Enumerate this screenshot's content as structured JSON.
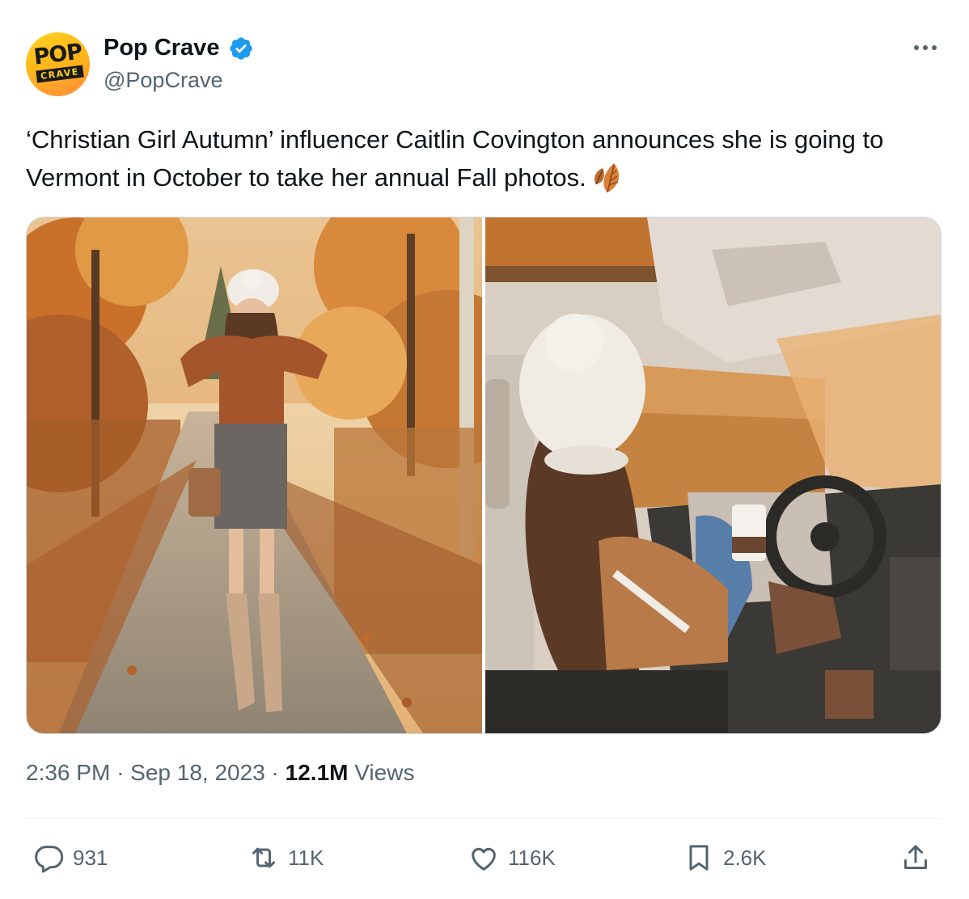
{
  "author": {
    "display_name": "Pop Crave",
    "handle": "@PopCrave",
    "avatar_word": "POP",
    "avatar_tag": "CRAVE",
    "verified": true,
    "verified_color": "#1d9bf0"
  },
  "tweet": {
    "text": "‘Christian Girl Autumn’ influencer Caitlin Covington announces she is going to Vermont in October to take her annual Fall photos.",
    "emoji": "leaves-icon"
  },
  "media": [
    {
      "icon": "photo-woman-autumn-road"
    },
    {
      "icon": "photo-woman-in-car"
    }
  ],
  "meta": {
    "time": "2:36 PM",
    "date": "Sep 18, 2023",
    "views_count": "12.1M",
    "views_label": "Views",
    "separator": "·"
  },
  "actions": {
    "replies": "931",
    "reposts": "11K",
    "likes": "116K",
    "bookmarks": "2.6K"
  },
  "colors": {
    "text": "#0f1419",
    "secondary": "#536471",
    "border": "#cfd9de",
    "brand_yellow": "#ffd21f"
  }
}
